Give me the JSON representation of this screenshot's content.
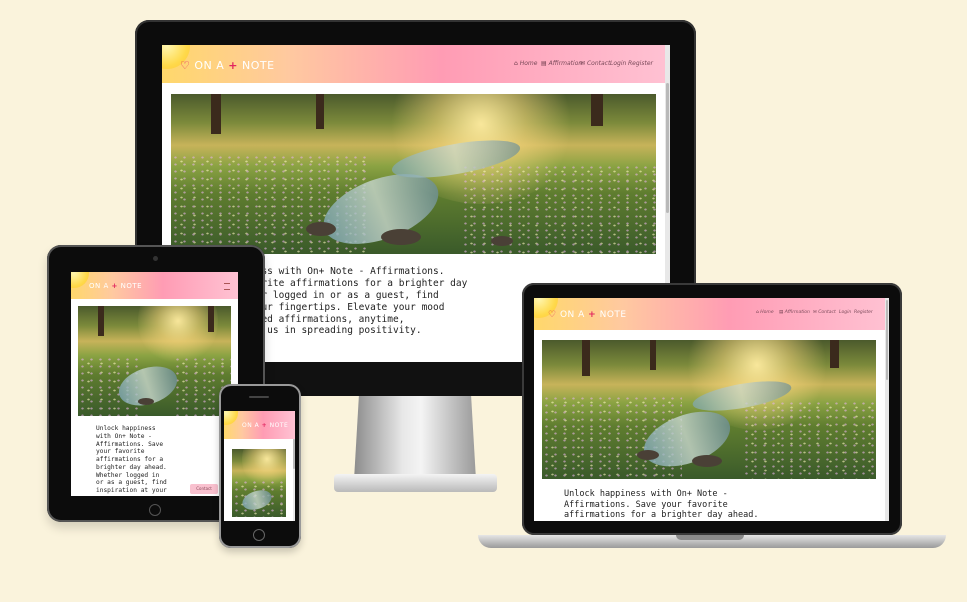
{
  "site": {
    "brand_prefix": "ON A",
    "brand_plus": "+",
    "brand_suffix": "NOTE",
    "nav": [
      {
        "icon": "home-icon",
        "glyph": "⌂",
        "label": "Home"
      },
      {
        "icon": "affirmations-icon",
        "glyph": "▤",
        "label": "Affirmation"
      },
      {
        "icon": "contact-icon",
        "glyph": "✉",
        "label": "Contact"
      },
      {
        "icon": "",
        "glyph": "",
        "label": "Login"
      },
      {
        "icon": "",
        "glyph": "",
        "label": "Register"
      }
    ],
    "intro_desktop": [
      "ness with On+ Note - Affirmations.",
      "vorite affirmations for a brighter day",
      "her logged in or as a guest, find",
      " your fingertips. Elevate your mood",
      "ized affirmations, anytime,",
      "in us in spreading positivity."
    ],
    "intro_laptop": [
      "Unlock happiness with On+ Note -",
      "Affirmations. Save your favorite",
      "affirmations for a brighter day ahead."
    ],
    "intro_tablet": [
      "Unlock happiness",
      "with On+ Note -",
      "Affirmations. Save",
      "your favorite",
      "affirmations for a",
      "brighter day ahead.",
      "Whether logged in",
      "or as a guest, find",
      "inspiration at your"
    ],
    "tablet_button": "Contact"
  },
  "colors": {
    "page_bg": "#faf3dc",
    "header_start": "#ffd86b",
    "header_mid": "#ff9cb4",
    "brand_accent": "#e2265f"
  }
}
